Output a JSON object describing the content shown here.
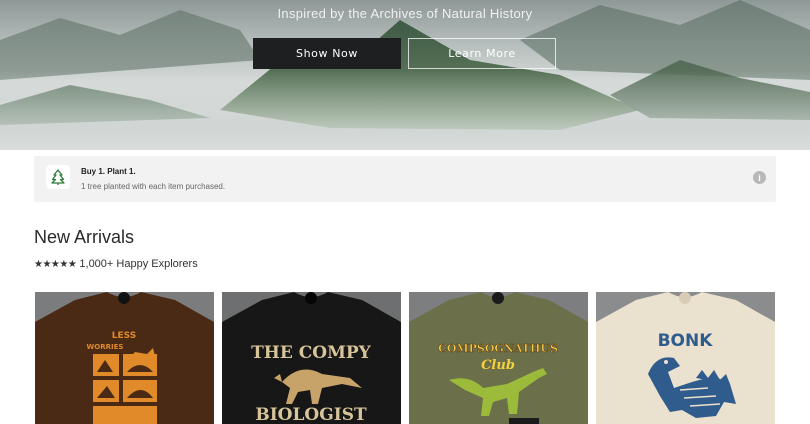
{
  "hero": {
    "tagline": "Inspired by the Archives of Natural History",
    "primary_button": "Show Now",
    "secondary_button": "Learn More"
  },
  "promo": {
    "icon": "tree-icon",
    "title": "Buy 1. Plant 1.",
    "subtitle": "1 tree planted with each item purchased.",
    "info_icon": "info-icon"
  },
  "new_arrivals": {
    "title": "New Arrivals",
    "stars": "★★★★★",
    "rating_text": "1,000+ Happy Explorers"
  },
  "products": [
    {
      "name": "Less Worries brown tee",
      "shirt_color": "#4a2a14",
      "print_text_top": "LESS",
      "print_text_bottom": "WORRIES"
    },
    {
      "name": "The Compy Biologist black tee",
      "shirt_color": "#171717",
      "print_text_top": "THE COMPY",
      "print_text_bottom": "BIOLOGIST"
    },
    {
      "name": "Compsognathus Club olive tee",
      "shirt_color": "#6b6f4a",
      "print_text_top": "COMPSOGNATHUS",
      "print_text_bottom": "Club"
    },
    {
      "name": "Bonk cream tee",
      "shirt_color": "#ebe1cf",
      "print_text_top": "BONK",
      "print_text_bottom": ""
    }
  ]
}
